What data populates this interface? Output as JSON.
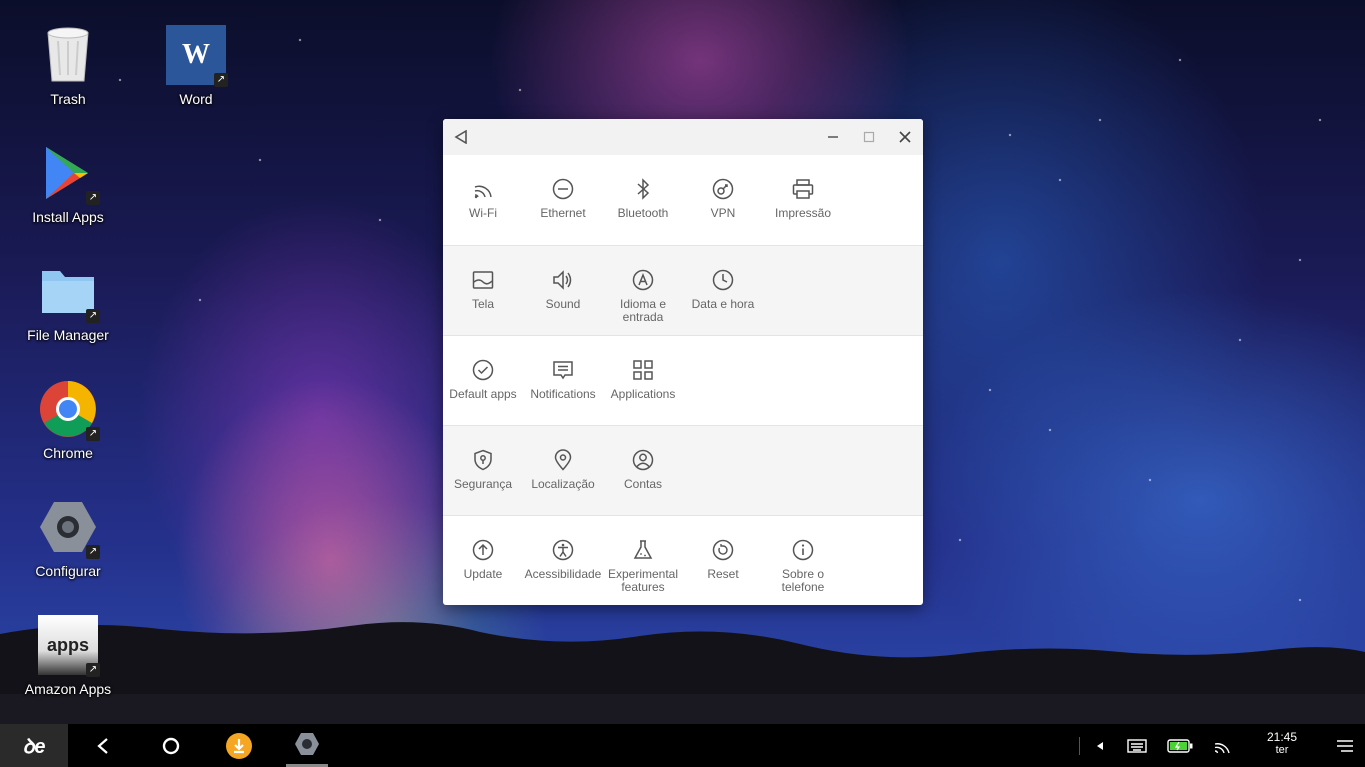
{
  "desktop": {
    "icons": [
      {
        "label": "Trash",
        "icon": "trash-icon"
      },
      {
        "label": "Word",
        "icon": "word-icon"
      },
      {
        "label": "Install Apps",
        "icon": "play-store-icon"
      },
      {
        "label": "File Manager",
        "icon": "folder-icon"
      },
      {
        "label": "Chrome",
        "icon": "chrome-icon"
      },
      {
        "label": "Configurar",
        "icon": "settings-hex-icon"
      },
      {
        "label": "Amazon Apps",
        "icon": "amazon-apps-icon",
        "badge": "apps"
      }
    ],
    "word_glyph": "W"
  },
  "settings": {
    "titlebar": {
      "back": "back-arrow-icon",
      "minimize": "minimize-icon",
      "maximize": "maximize-icon",
      "close": "close-icon"
    },
    "sections": [
      {
        "items": [
          {
            "label": "Wi-Fi",
            "icon": "wifi-icon"
          },
          {
            "label": "Ethernet",
            "icon": "ethernet-icon"
          },
          {
            "label": "Bluetooth",
            "icon": "bluetooth-icon"
          },
          {
            "label": "VPN",
            "icon": "vpn-key-icon"
          },
          {
            "label": "Impressão",
            "icon": "printer-icon"
          }
        ]
      },
      {
        "items": [
          {
            "label": "Tela",
            "icon": "display-icon"
          },
          {
            "label": "Sound",
            "icon": "speaker-icon"
          },
          {
            "label": "Idioma e entrada",
            "icon": "language-icon"
          },
          {
            "label": "Data e hora",
            "icon": "clock-icon"
          }
        ]
      },
      {
        "items": [
          {
            "label": "Default apps",
            "icon": "check-circle-icon"
          },
          {
            "label": "Notifications",
            "icon": "notification-icon"
          },
          {
            "label": "Applications",
            "icon": "apps-grid-icon"
          }
        ]
      },
      {
        "items": [
          {
            "label": "Segurança",
            "icon": "shield-icon"
          },
          {
            "label": "Localização",
            "icon": "location-pin-icon"
          },
          {
            "label": "Contas",
            "icon": "account-icon"
          }
        ]
      },
      {
        "items": [
          {
            "label": "Update",
            "icon": "update-arrow-icon"
          },
          {
            "label": "Acessibilidade",
            "icon": "accessibility-icon"
          },
          {
            "label": "Experimental features",
            "icon": "flask-icon"
          },
          {
            "label": "Reset",
            "icon": "reset-icon"
          },
          {
            "label": "Sobre o telefone",
            "icon": "info-icon"
          }
        ]
      }
    ]
  },
  "taskbar": {
    "start": "start-menu-icon",
    "start_glyph": "ꝺe",
    "clock": {
      "time": "21:45",
      "day": "ter"
    }
  }
}
